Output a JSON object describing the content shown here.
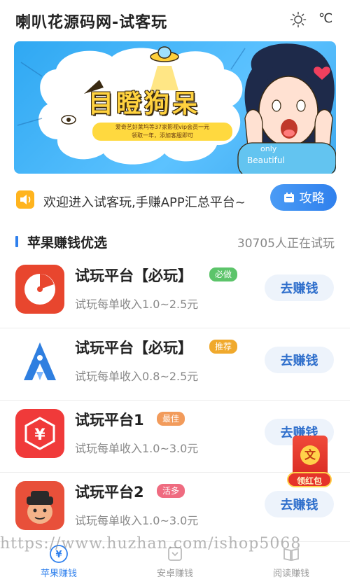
{
  "header": {
    "title": "喇叭花源码网-试客玩",
    "temperature": "℃"
  },
  "banner": {
    "title": "目瞪狗呆",
    "subtitle_line1": "爱奇艺好莱坞等37家影视vip会员一元",
    "subtitle_line2": "领取一年，添加客服即可",
    "only_text": "only",
    "beautiful_text": "Beautiful"
  },
  "notice": {
    "text": "欢迎进入试客玩,手赚APP汇总平台~",
    "guide_label": "攻略"
  },
  "section": {
    "title": "苹果赚钱优选",
    "count_text": "30705人正在试玩"
  },
  "items": [
    {
      "name": "试玩平台【必玩】",
      "tag": "必做",
      "tag_color": "#5cc46a",
      "desc": "试玩每单收入1.0~2.5元",
      "button": "去赚钱"
    },
    {
      "name": "试玩平台【必玩】",
      "tag": "推荐",
      "tag_color": "#f0a92c",
      "desc": "试玩每单收入0.8~2.5元",
      "button": "去赚钱"
    },
    {
      "name": "试玩平台1",
      "tag": "最佳",
      "tag_color": "#f29b5b",
      "desc": "试玩每单收入1.0~3.0元",
      "button": "去赚钱"
    },
    {
      "name": "试玩平台2",
      "tag": "活多",
      "tag_color": "#ef6b80",
      "desc": "试玩每单收入1.0~3.0元",
      "button": "去赚钱"
    }
  ],
  "red_packet": {
    "coin_char": "文",
    "label": "领红包"
  },
  "watermark": "https://www.huzhan.com/ishop5068",
  "bottom_nav": [
    {
      "label": "苹果赚钱",
      "icon": "apple-earn-icon",
      "active": true
    },
    {
      "label": "安卓赚钱",
      "icon": "android-earn-icon",
      "active": false
    },
    {
      "label": "阅读赚钱",
      "icon": "book-icon",
      "active": false
    }
  ],
  "colors": {
    "accent": "#2f80ed",
    "banner_bg": "#3ea9ef"
  }
}
